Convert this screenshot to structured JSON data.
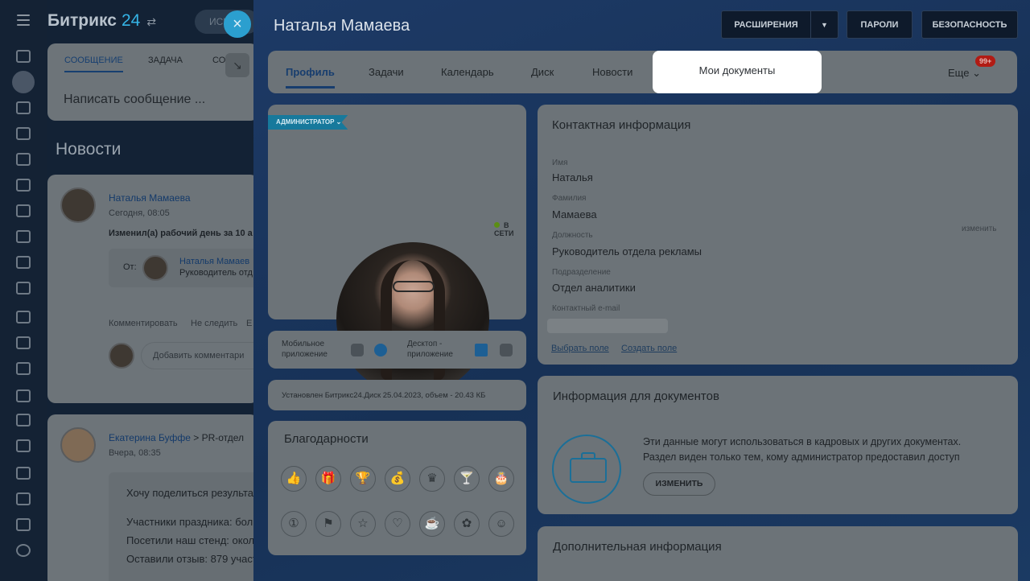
{
  "bg": {
    "logo": "Битрикс",
    "logo_num": "24",
    "logo_switch": "⇄",
    "search": "ИСК",
    "tabs": [
      "СООБЩЕНИЕ",
      "ЗАДАЧА",
      "СО"
    ],
    "compose_placeholder": "Написать сообщение ...",
    "news_title": "Новости",
    "post1": {
      "author": "Наталья Мамаева",
      "time": "Сегодня, 08:05",
      "text": "Изменил(а) рабочий день за 10 а",
      "from_label": "От:",
      "from_name": "Наталья Мамаев",
      "from_role": "Руководитель отд",
      "actions": [
        "Комментировать",
        "Не следить",
        "Е"
      ],
      "comment_placeholder": "Добавить комментари"
    },
    "post2": {
      "author": "Екатерина Буффе",
      "arrow": ">",
      "dest": "PR-отдел",
      "time": "Вчера, 08:35",
      "lines": [
        "Хочу поделиться результат",
        "Участники праздника: бол",
        "Посетили наш стенд: окол",
        "Оставили отзыв: 879 участ"
      ]
    }
  },
  "panel": {
    "close_icon": "×",
    "title": "Наталья Мамаева",
    "buttons": {
      "extensions": "РАСШИРЕНИЯ",
      "extensions_caret": "▼",
      "passwords": "ПАРОЛИ",
      "security": "БЕЗОПАСНОСТЬ"
    },
    "tabs": [
      "Профиль",
      "Задачи",
      "Календарь",
      "Диск",
      "Новости"
    ],
    "highlighted_tab": "Мои документы",
    "more": "Еще",
    "more_caret": "⌄",
    "badge": "99+",
    "profile": {
      "role_tag": "АДМИНИСТРАТОР",
      "role_caret": "⌄",
      "status": "В СЕТИ"
    },
    "apps": {
      "mobile": [
        "Мобильное",
        "приложение"
      ],
      "desktop": [
        "Десктоп -",
        "приложение"
      ]
    },
    "disk_note": "Установлен Битрикс24.Диск 25.04.2023, объем - 20.43 КБ",
    "gratitude": {
      "title": "Благодарности",
      "icons": [
        "👍",
        "🎁",
        "🏆",
        "💰",
        "♛",
        "🍸",
        "🎂",
        "①",
        "⚑",
        "☆",
        "♡",
        "☕",
        "✿",
        "☺"
      ]
    },
    "contact": {
      "title": "Контактная информация",
      "edit": "изменить",
      "fields": [
        {
          "label": "Имя",
          "value": "Наталья"
        },
        {
          "label": "Фамилия",
          "value": "Мамаева"
        },
        {
          "label": "Должность",
          "value": "Руководитель отдела рекламы"
        },
        {
          "label": "Подразделение",
          "value": "Отдел аналитики"
        },
        {
          "label": "Контактный e-mail",
          "value": ""
        }
      ],
      "links": [
        "Выбрать поле",
        "Создать поле"
      ]
    },
    "docs": {
      "title": "Информация для документов",
      "desc": [
        "Эти данные могут использоваться в кадровых и других документах.",
        "Раздел виден только тем, кому администратор предоставил доступ"
      ],
      "button": "ИЗМЕНИТЬ"
    },
    "additional": {
      "title": "Дополнительная информация"
    }
  }
}
